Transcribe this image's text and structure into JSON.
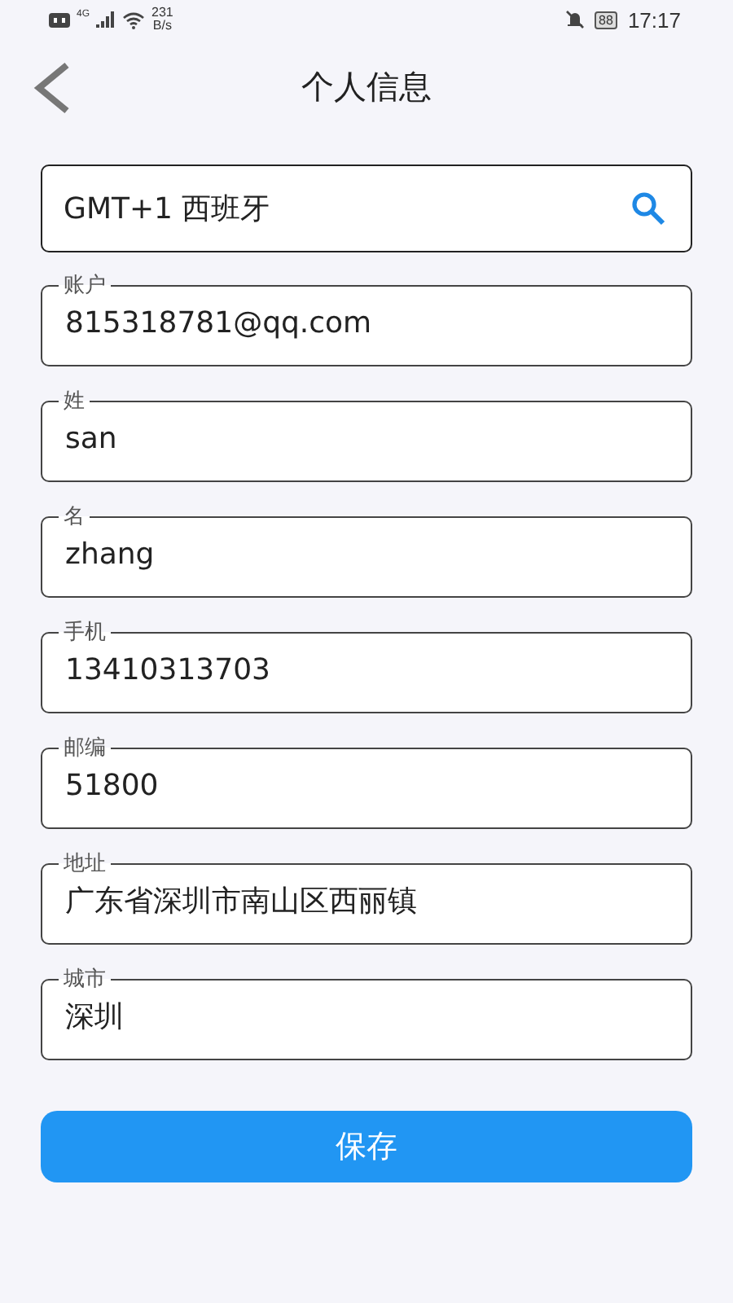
{
  "status_bar": {
    "network": "4G",
    "speed_value": "231",
    "speed_unit": "B/s",
    "battery": "88",
    "time": "17:17"
  },
  "header": {
    "title": "个人信息"
  },
  "timezone": {
    "value": "GMT+1 西班牙"
  },
  "fields": [
    {
      "label": "账户",
      "value": "815318781@qq.com"
    },
    {
      "label": "姓",
      "value": "san"
    },
    {
      "label": "名",
      "value": "zhang"
    },
    {
      "label": "手机",
      "value": "13410313703"
    },
    {
      "label": "邮编",
      "value": "51800"
    },
    {
      "label": "地址",
      "value": "广东省深圳市南山区西丽镇"
    },
    {
      "label": "城市",
      "value": "深圳"
    }
  ],
  "save_button": "保存"
}
